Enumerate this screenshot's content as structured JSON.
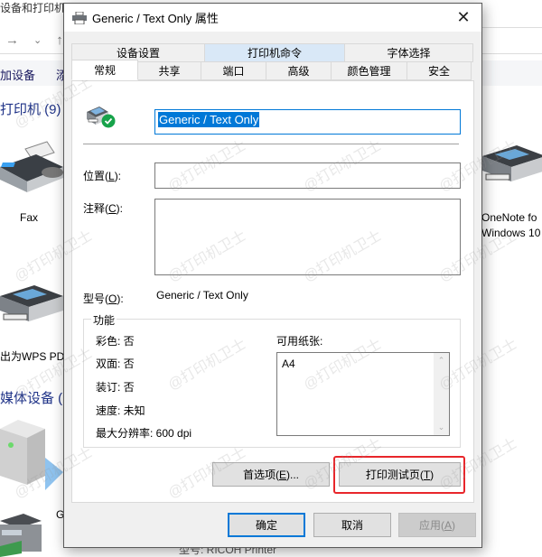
{
  "background": {
    "window_title": "设备和打印机",
    "nav": {
      "forward": "→",
      "dropdown": "⌄",
      "up": "↑"
    },
    "toolbar": {
      "add_device": "加设备",
      "add_printer_partial": "添"
    },
    "sections": {
      "printers": "打印机 (9)",
      "multimedia": "媒体设备 ("
    },
    "items": {
      "fax": "Fax",
      "wps": "出为WPS PD",
      "onenote_line1": "OneNote fo",
      "onenote_line2": "Windows 10",
      "generic_partial": "G",
      "model_partial": "型号:   RICOH Printer"
    }
  },
  "dialog": {
    "title": "Generic / Text Only 属性",
    "close_glyph": "✕",
    "tabs_row1": [
      {
        "label": "设备设置",
        "highlighted": false
      },
      {
        "label": "打印机命令",
        "highlighted": true
      },
      {
        "label": "字体选择",
        "highlighted": false
      }
    ],
    "tabs_row2": [
      {
        "label": "常规",
        "active": true
      },
      {
        "label": "共享",
        "active": false
      },
      {
        "label": "端口",
        "active": false
      },
      {
        "label": "高级",
        "active": false
      },
      {
        "label": "颜色管理",
        "active": false
      },
      {
        "label": "安全",
        "active": false
      }
    ],
    "general": {
      "printer_name": "Generic / Text Only",
      "location_label": "位置(",
      "location_key": "L",
      "location_label_end": "):",
      "location_value": "",
      "comment_label": "注释(",
      "comment_key": "C",
      "comment_label_end": "):",
      "comment_value": "",
      "model_label": "型号(",
      "model_key": "O",
      "model_label_end": "):",
      "model_value": "Generic / Text Only",
      "features": {
        "legend": "功能",
        "items": [
          "彩色: 否",
          "双面: 否",
          "装订: 否",
          "速度: 未知",
          "最大分辨率: 600 dpi"
        ],
        "paper_label": "可用纸张:",
        "paper_items": [
          "A4"
        ]
      },
      "preferences_button": {
        "label": "首选项(",
        "key": "E",
        "end": ")..."
      },
      "print_test_button": {
        "label": "打印测试页(",
        "key": "T",
        "end": ")"
      }
    },
    "footer": {
      "ok": "确定",
      "cancel": "取消",
      "apply": {
        "label": "应用(",
        "key": "A",
        "end": ")"
      }
    }
  },
  "watermark": "@打印机卫士",
  "colors": {
    "accent": "#0078d7",
    "highlight_box": "#e8262b",
    "tab_highlight": "#d9e8f7"
  }
}
